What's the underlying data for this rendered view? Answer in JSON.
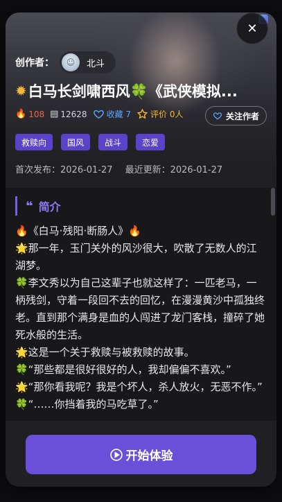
{
  "creator": {
    "label": "创作者：",
    "name": "北斗"
  },
  "title": {
    "icon": "star-icon",
    "text": "白马长剑啸西风🍀《武侠模拟..."
  },
  "stats": {
    "hot": "108",
    "words": "12628",
    "favorites": "收藏 7",
    "rating": "评价 0人"
  },
  "follow_button": "关注作者",
  "tags": [
    "救赎向",
    "国风",
    "战斗",
    "恋爱"
  ],
  "dates": {
    "published": "首次发布：2026-01-27",
    "updated": "最近更新：2026-01-27"
  },
  "intro": {
    "heading": "简介",
    "lines": [
      "🔥《白马·残阳·断肠人》🔥",
      "🌟那一年，玉门关外的风沙很大，吹散了无数人的江湖梦。",
      "🍀李文秀以为自己这辈子也就这样了：一匹老马，一柄残剑，守着一段回不去的回忆，在漫漫黄沙中孤独终老。直到那个满身是血的人闯进了龙门客栈，撞碎了她死水般的生活。",
      "🌟这是一个关于救赎与被救赎的故事。",
      "🍀“那些都是很好很好的人，我却偏偏不喜欢。”",
      "🌟“那你看我呢？我是个坏人，杀人放火，无恶不作。”",
      "🍀“……你挡着我的马吃草了。”"
    ]
  },
  "start_button": "开始体验",
  "colors": {
    "accent": "#6a4fd8",
    "tag": "#5a42c9",
    "hot": "#f06450",
    "favorite": "#5ba6ff",
    "rating": "#f5b935"
  }
}
